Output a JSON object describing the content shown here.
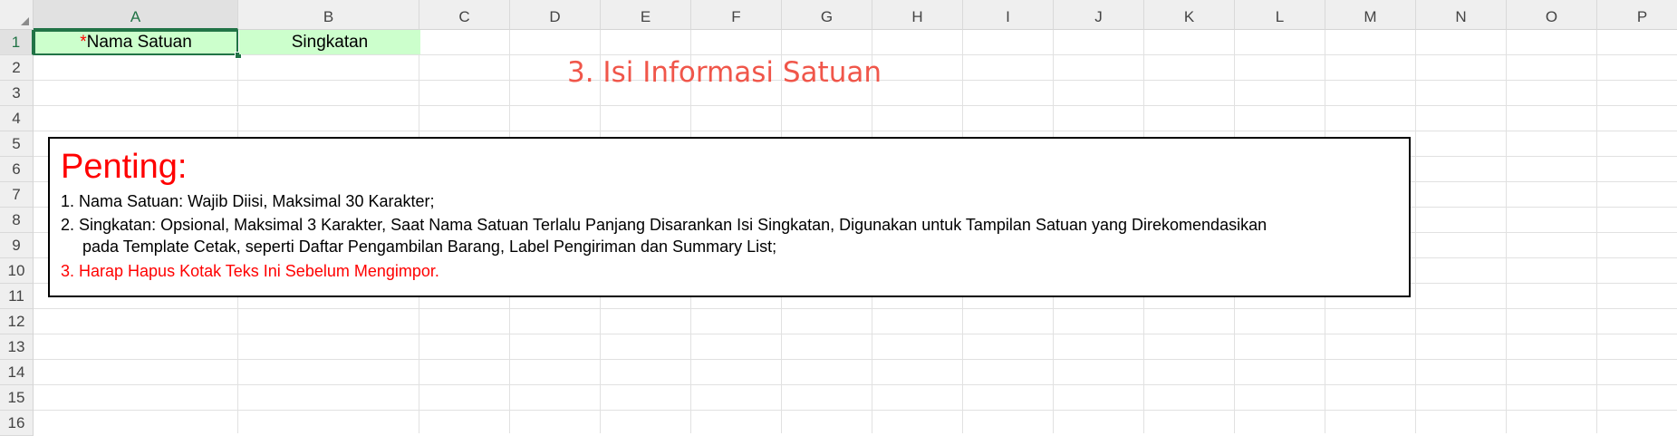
{
  "columns": [
    "A",
    "B",
    "C",
    "D",
    "E",
    "F",
    "G",
    "H",
    "I",
    "J",
    "K",
    "L",
    "M",
    "N",
    "O",
    "P"
  ],
  "rows": [
    "1",
    "2",
    "3",
    "4",
    "5",
    "6",
    "7",
    "8",
    "9",
    "10",
    "11",
    "12",
    "13",
    "14",
    "15",
    "16"
  ],
  "active_column": "A",
  "active_row": "1",
  "cells": {
    "a1_required_mark": "*",
    "a1_label": "Nama Satuan",
    "b1": "Singkatan"
  },
  "annotation": "3. Isi Informasi Satuan",
  "textbox": {
    "heading": "Penting:",
    "line1": "1. Nama Satuan: Wajib Diisi, Maksimal 30 Karakter;",
    "line2": "2. Singkatan: Opsional, Maksimal 3 Karakter, Saat Nama Satuan Terlalu Panjang Disarankan Isi Singkatan, Digunakan untuk Tampilan Satuan yang Direkomendasikan",
    "line2_cont": "pada Template Cetak, seperti Daftar Pengambilan Barang, Label Pengiriman dan Summary List;",
    "line3": "3. Harap Hapus Kotak Teks Ini Sebelum Mengimpor."
  },
  "colors": {
    "header_cell_fill": "#ccffcc",
    "selection": "#217346",
    "required_mark": "#ff0000",
    "annotation": "#f0564a",
    "warning_text": "#ff0000"
  }
}
